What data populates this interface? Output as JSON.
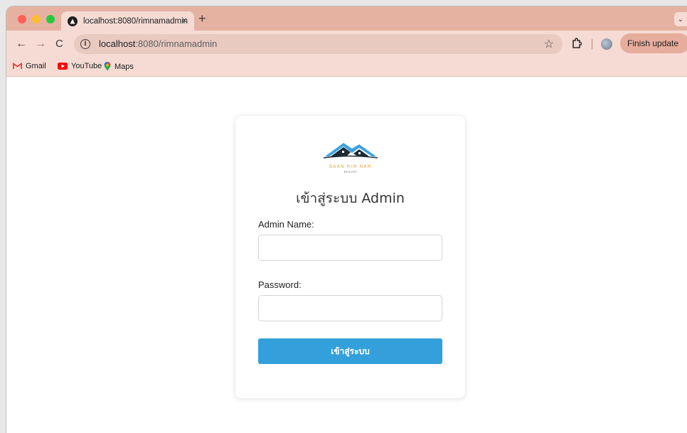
{
  "browser": {
    "tab": {
      "title": "localhost:8080/rimnamadmin",
      "close_glyph": "×"
    },
    "new_tab_glyph": "+",
    "tab_menu_glyph": "⌄",
    "address": {
      "host": "localhost",
      "path": ":8080/rimnamadmin"
    },
    "nav": {
      "back": "←",
      "forward": "→",
      "reload": "C"
    },
    "star_glyph": "☆",
    "finish_update_label": "Finish update",
    "menu_glyph": "⋮",
    "bookmarks": [
      {
        "label": "Gmail",
        "icon": "gmail-icon"
      },
      {
        "label": "YouTube",
        "icon": "youtube-icon"
      },
      {
        "label": "Maps",
        "icon": "maps-icon"
      }
    ]
  },
  "colors": {
    "tab_strip": "#e5b2a2",
    "toolbar": "#f5dbd3",
    "accent_button": "#33a0db",
    "logo_text": "#e8a64a"
  },
  "login": {
    "logo": {
      "name": "BAAN RIM NAM",
      "sub": "RESORT"
    },
    "title": "เข้าสู่ระบบ Admin",
    "admin_name_label": "Admin Name:",
    "admin_name_value": "",
    "password_label": "Password:",
    "password_value": "",
    "submit_label": "เข้าสู่ระบบ"
  }
}
